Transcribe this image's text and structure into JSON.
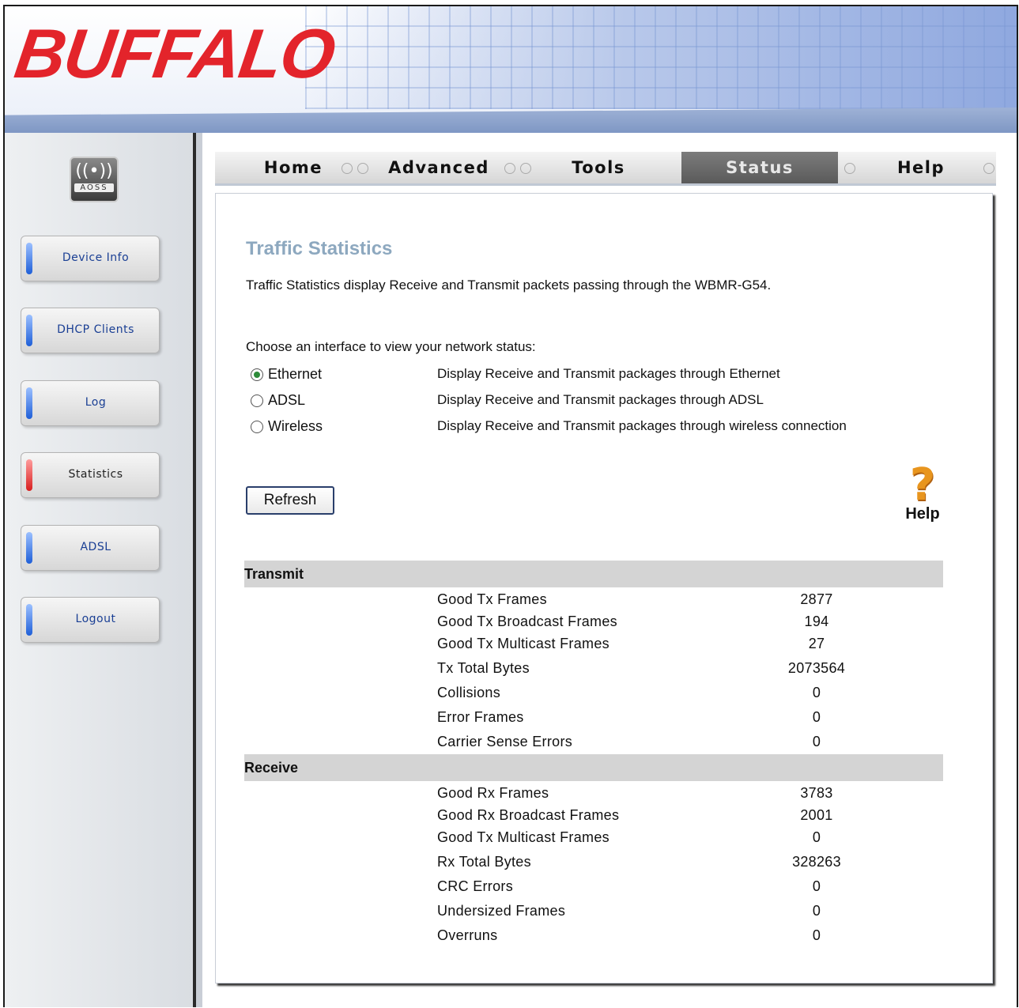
{
  "header": {
    "logo": "BUFFALO"
  },
  "sidebar": {
    "aoss_label": "AOSS",
    "items": [
      {
        "label": "Device Info",
        "active": false
      },
      {
        "label": "DHCP Clients",
        "active": false
      },
      {
        "label": "Log",
        "active": false
      },
      {
        "label": "Statistics",
        "active": true
      },
      {
        "label": "ADSL",
        "active": false
      },
      {
        "label": "Logout",
        "active": false
      }
    ]
  },
  "tabs": [
    {
      "label": "Home",
      "active": false
    },
    {
      "label": "Advanced",
      "active": false
    },
    {
      "label": "Tools",
      "active": false
    },
    {
      "label": "Status",
      "active": true
    },
    {
      "label": "Help",
      "active": false
    }
  ],
  "main": {
    "title": "Traffic Statistics",
    "description": "Traffic Statistics display Receive and Transmit packets passing through the WBMR-G54.",
    "choose_label": "Choose an interface to view your network status:",
    "interfaces": [
      {
        "label": "Ethernet",
        "description": "Display Receive and Transmit packages through Ethernet",
        "selected": true
      },
      {
        "label": "ADSL",
        "description": "Display Receive and Transmit packages through ADSL",
        "selected": false
      },
      {
        "label": "Wireless",
        "description": "Display Receive and Transmit packages through wireless connection",
        "selected": false
      }
    ],
    "refresh_label": "Refresh",
    "help_label": "Help",
    "help_icon": "question-mark-icon",
    "transmit": {
      "header": "Transmit",
      "rows": [
        {
          "label": "Good Tx Frames",
          "value": "2877"
        },
        {
          "label": "Good Tx Broadcast Frames",
          "value": "194"
        },
        {
          "label": "Good Tx Multicast Frames",
          "value": "27"
        },
        {
          "label": "Tx Total Bytes",
          "value": "2073564"
        },
        {
          "label": "Collisions",
          "value": "0"
        },
        {
          "label": "Error Frames",
          "value": "0"
        },
        {
          "label": "Carrier Sense Errors",
          "value": "0"
        }
      ]
    },
    "receive": {
      "header": "Receive",
      "rows": [
        {
          "label": "Good Rx Frames",
          "value": "3783"
        },
        {
          "label": "Good Rx Broadcast Frames",
          "value": "2001"
        },
        {
          "label": "Good Tx Multicast Frames",
          "value": "0"
        },
        {
          "label": "Rx Total Bytes",
          "value": "328263"
        },
        {
          "label": "CRC Errors",
          "value": "0"
        },
        {
          "label": "Undersized Frames",
          "value": "0"
        },
        {
          "label": "Overruns",
          "value": "0"
        }
      ]
    }
  },
  "colors": {
    "brand_red": "#e3242b",
    "title": "#8da8bf",
    "active_tab": "#5a5a5a",
    "radio_on": "#2e8b3a"
  }
}
